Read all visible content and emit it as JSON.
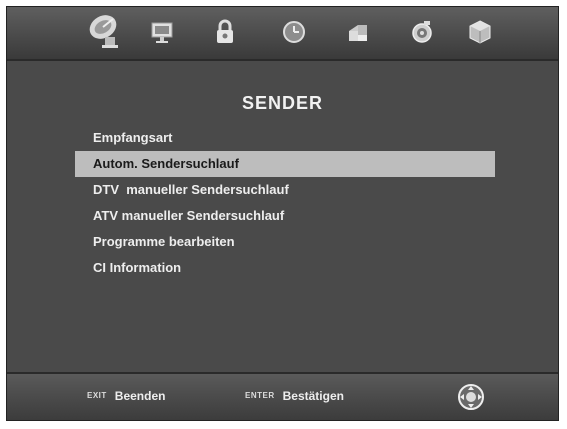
{
  "top_icons": [
    {
      "name": "satellite-dish-icon"
    },
    {
      "name": "monitor-icon"
    },
    {
      "name": "lock-icon"
    },
    {
      "name": "clock-icon"
    },
    {
      "name": "puzzle-icon"
    },
    {
      "name": "speaker-icon"
    },
    {
      "name": "gear-cube-icon"
    }
  ],
  "menu": {
    "title": "SENDER",
    "items": [
      {
        "label": "Empfangsart",
        "selected": false
      },
      {
        "label": "Autom. Sendersuchlauf",
        "selected": true
      },
      {
        "label": "DTV  manueller Sendersuchlauf",
        "selected": false
      },
      {
        "label": "ATV manueller Sendersuchlauf",
        "selected": false
      },
      {
        "label": "Programme bearbeiten",
        "selected": false
      },
      {
        "label": "CI Information",
        "selected": false
      }
    ]
  },
  "footer": {
    "exit_key": "EXIT",
    "exit_label": "Beenden",
    "enter_key": "ENTER",
    "enter_label": "Bestätigen"
  },
  "colors": {
    "background": "#4a4a4a",
    "selection": "#bdbdbd"
  }
}
